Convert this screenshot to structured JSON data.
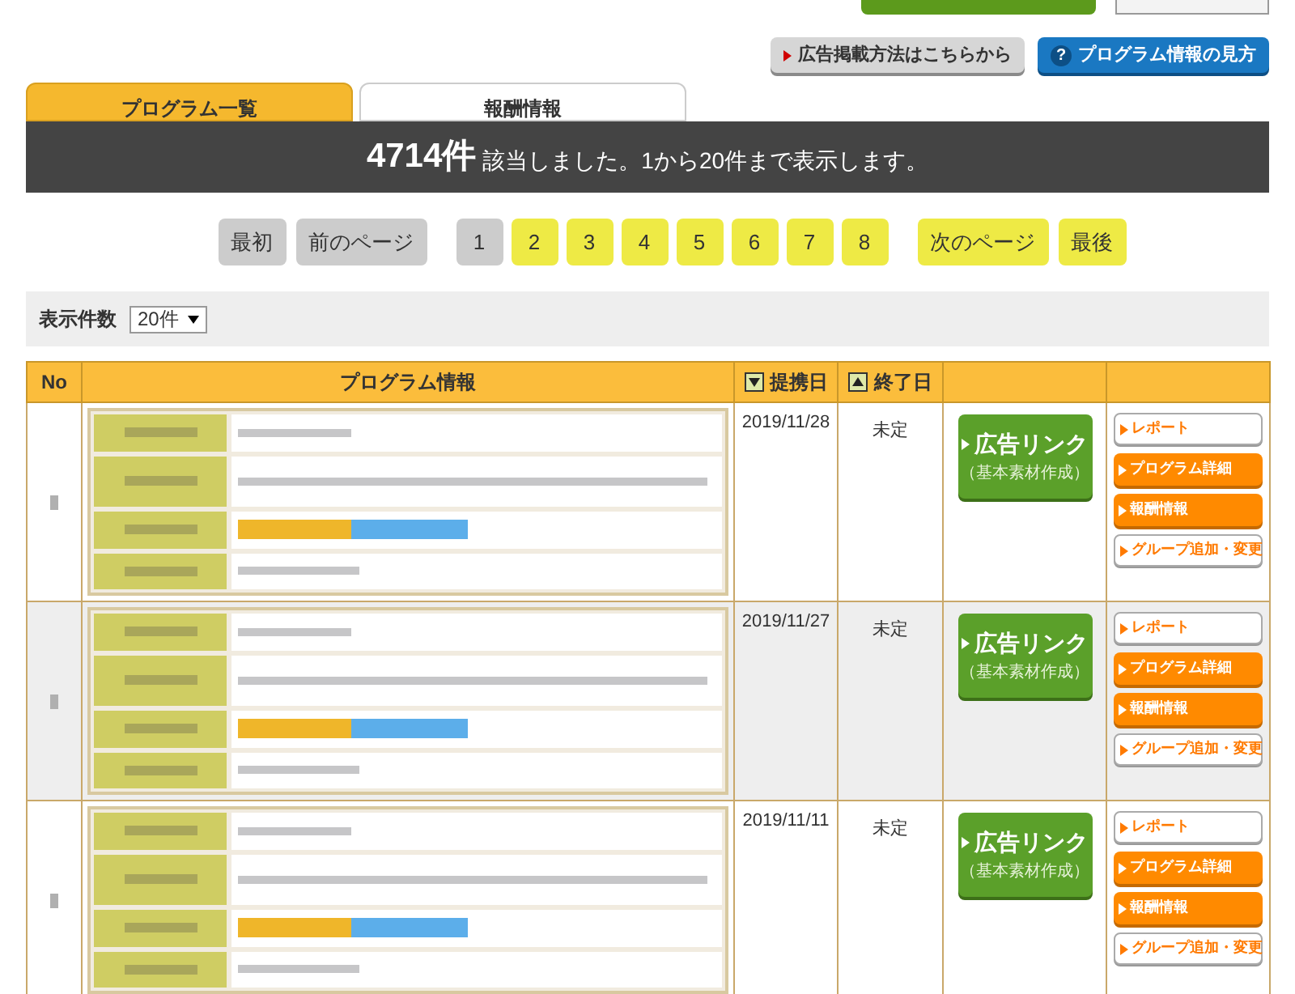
{
  "help_links": [
    {
      "kind": "ad",
      "label": "広告掲載方法はこちらから"
    },
    {
      "kind": "help",
      "icon": "?",
      "label": "プログラム情報の見方"
    }
  ],
  "tabs": [
    {
      "label": "プログラム一覧",
      "selected": true
    },
    {
      "label": "報酬情報",
      "selected": false
    }
  ],
  "result_banner": {
    "count": "4714件",
    "message": "該当しました。1から20件まで表示します。"
  },
  "pagination": {
    "first": {
      "label": "最初",
      "disabled": true
    },
    "prev": {
      "label": "前のページ",
      "disabled": true
    },
    "pages": [
      {
        "label": "1",
        "selected": true
      },
      {
        "label": "2",
        "selected": false
      },
      {
        "label": "3",
        "selected": false
      },
      {
        "label": "4",
        "selected": false
      },
      {
        "label": "5",
        "selected": false
      },
      {
        "label": "6",
        "selected": false
      },
      {
        "label": "7",
        "selected": false
      },
      {
        "label": "8",
        "selected": false
      }
    ],
    "next": {
      "label": "次のページ",
      "disabled": false
    },
    "last": {
      "label": "最後",
      "disabled": false
    }
  },
  "per_page": {
    "label": "表示件数",
    "value": "20件"
  },
  "table": {
    "columns": [
      {
        "label": "No"
      },
      {
        "label": "プログラム情報"
      },
      {
        "label": "提携日",
        "sort_descending": true
      },
      {
        "label": "終了日",
        "sort_descending": false
      }
    ],
    "rows": [
      {
        "selected": false,
        "partner_date": "2019/11/28",
        "end_date": "未定",
        "ad_link": "広告リンク",
        "ad_link_sub": "（基本素材作成）",
        "actions": [
          {
            "kind": "outline",
            "label": "レポート"
          },
          {
            "kind": "filled",
            "label": "プログラム詳細"
          },
          {
            "kind": "filled",
            "label": "報酬情報"
          },
          {
            "kind": "outline",
            "label": "グループ追加・変更"
          }
        ]
      },
      {
        "selected": true,
        "partner_date": "2019/11/27",
        "end_date": "未定",
        "ad_link": "広告リンク",
        "ad_link_sub": "（基本素材作成）",
        "actions": [
          {
            "kind": "outline",
            "label": "レポート"
          },
          {
            "kind": "filled",
            "label": "プログラム詳細"
          },
          {
            "kind": "filled",
            "label": "報酬情報"
          },
          {
            "kind": "outline",
            "label": "グループ追加・変更"
          }
        ]
      },
      {
        "selected": false,
        "partner_date": "2019/11/11",
        "end_date": "未定",
        "ad_link": "広告リンク",
        "ad_link_sub": "（基本素材作成）",
        "actions": [
          {
            "kind": "outline",
            "label": "レポート"
          },
          {
            "kind": "filled",
            "label": "プログラム詳細"
          },
          {
            "kind": "filled",
            "label": "報酬情報"
          },
          {
            "kind": "outline",
            "label": "グループ追加・変更"
          }
        ]
      }
    ]
  }
}
